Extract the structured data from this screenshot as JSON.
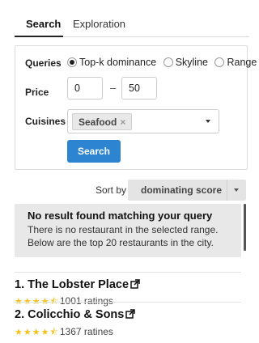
{
  "tabs": [
    {
      "label": "Search",
      "active": true
    },
    {
      "label": "Exploration",
      "active": false
    }
  ],
  "form": {
    "queries_label": "Queries",
    "query_options": [
      {
        "label": "Top-k dominance",
        "selected": true
      },
      {
        "label": "Skyline",
        "selected": false
      },
      {
        "label": "Range",
        "selected": false
      }
    ],
    "price_label": "Price",
    "price_min": "0",
    "price_separator": "–",
    "price_max": "50",
    "cuisines_label": "Cuisines",
    "cuisine_tag": "Seafood",
    "tag_remove": "×",
    "search_button": "Search"
  },
  "sort": {
    "label": "Sort by",
    "value": "dominating score"
  },
  "notice": {
    "title": "No result found matching your query",
    "message": "There is no restaurant in the selected range. Below are the top 20 restaurants in the city."
  },
  "results": [
    {
      "rank_title": "1. The Lobster Place",
      "rating": 4.5,
      "ratings_text": "1001 ratings"
    },
    {
      "rank_title": "2. Colicchio & Sons",
      "rating": 4.5,
      "ratings_text": "1367 ratines"
    }
  ],
  "colors": {
    "primary": "#2d85d1",
    "star": "#f4c21c",
    "notice_bg": "#e8e8e8"
  }
}
